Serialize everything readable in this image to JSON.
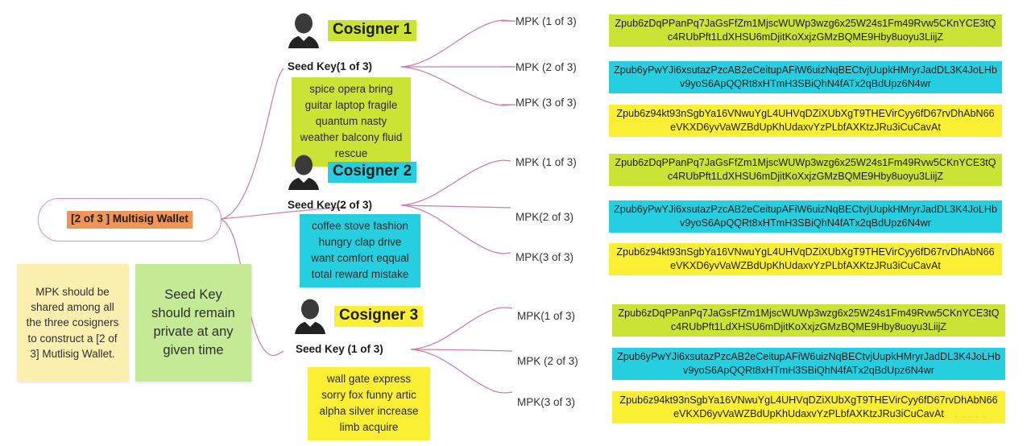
{
  "root": {
    "label": "[2 of 3 ] Multisig Wallet"
  },
  "notes": [
    {
      "id": "mpk-note",
      "text": "MPK should be shared among all the three cosigners to construct a [2 of 3] Mutlisig Wallet."
    },
    {
      "id": "seedkey-note",
      "text": "Seed Key should remain private at any given time"
    }
  ],
  "mpk_values": {
    "green": "Zpub6zDqPPanPq7JaGsFfZm1MjscWUWp3wzg6x25W24s1Fm49Rvw5CKnYCE3tQc4RUbPft1LdXHSU6mDjitKoXxjzGMzBQME9Hby8uoyu3LiijZ",
    "cyan": "Zpub6yPwYJi6xsutazPzcAB2eCeitupAFiW6uizNqBECtvjUupkHMryrJadDL3K4JoLHbv9yoS6ApQQRt8xHTmH3SBiQhN4fATx2qBdUpz6N4wr",
    "yellow": "Zpub6z94kt93nSgbYa16VNwuYgL4UHVqDZiXUbXgT9THEVirCyy6fD67rvDhAbN66eVKXD6yvVaWZBdUpKhUdaxvYzPLbfAXKtzJRu3iCuCavAt"
  },
  "cosigners": [
    {
      "title": "Cosigner 1",
      "title_color": "#cbe335",
      "seed_label": "Seed Key(1 of 3)",
      "seed_words": "spice opera bring guitar laptop fragile quantum nasty weather balcony fluid rescue",
      "seed_color": "#cbe335",
      "mpks": [
        {
          "label": "MPK (1 of 3)",
          "color": "#cbe335"
        },
        {
          "label": "MPK (2 of 3)",
          "color": "#26cfe0"
        },
        {
          "label": "MPK (3 of 3)",
          "color": "#fbef34"
        }
      ]
    },
    {
      "title": "Cosigner 2",
      "title_color": "#26cfe0",
      "seed_label": "Seed Key(2 of 3)",
      "seed_words": "coffee stove fashion hungry clap drive want comfort eqqual total reward mistake",
      "seed_color": "#26cfe0",
      "mpks": [
        {
          "label": "MPK (1 of 3)",
          "color": "#cbe335"
        },
        {
          "label": "MPK(2 of 3)",
          "color": "#26cfe0"
        },
        {
          "label": "MPK(3 of 3)",
          "color": "#fbef34"
        }
      ]
    },
    {
      "title": "Cosigner 3",
      "title_color": "#fbef34",
      "seed_label": "Seed Key (1 of 3)",
      "seed_words": "wall gate express sorry fox funny artic alpha silver increase limb acquire",
      "seed_color": "#fbef34",
      "mpks": [
        {
          "label": "MPK(1 of 3)",
          "color": "#cbe335"
        },
        {
          "label": "MPK (2 of 3)",
          "color": "#26cfe0"
        },
        {
          "label": "MPK(3 of 3)",
          "color": "#fbef34"
        }
      ]
    }
  ],
  "colors": {
    "connector": "#c77fb0",
    "root_border": "#d98fc0",
    "root_highlight": "#ef9557",
    "green": "#cbe335",
    "cyan": "#26cfe0",
    "yellow": "#fbef34",
    "note_yellow": "#fbf0b0",
    "note_green": "#c5ea95"
  },
  "watermark": {
    "text": "· · · · ·"
  }
}
